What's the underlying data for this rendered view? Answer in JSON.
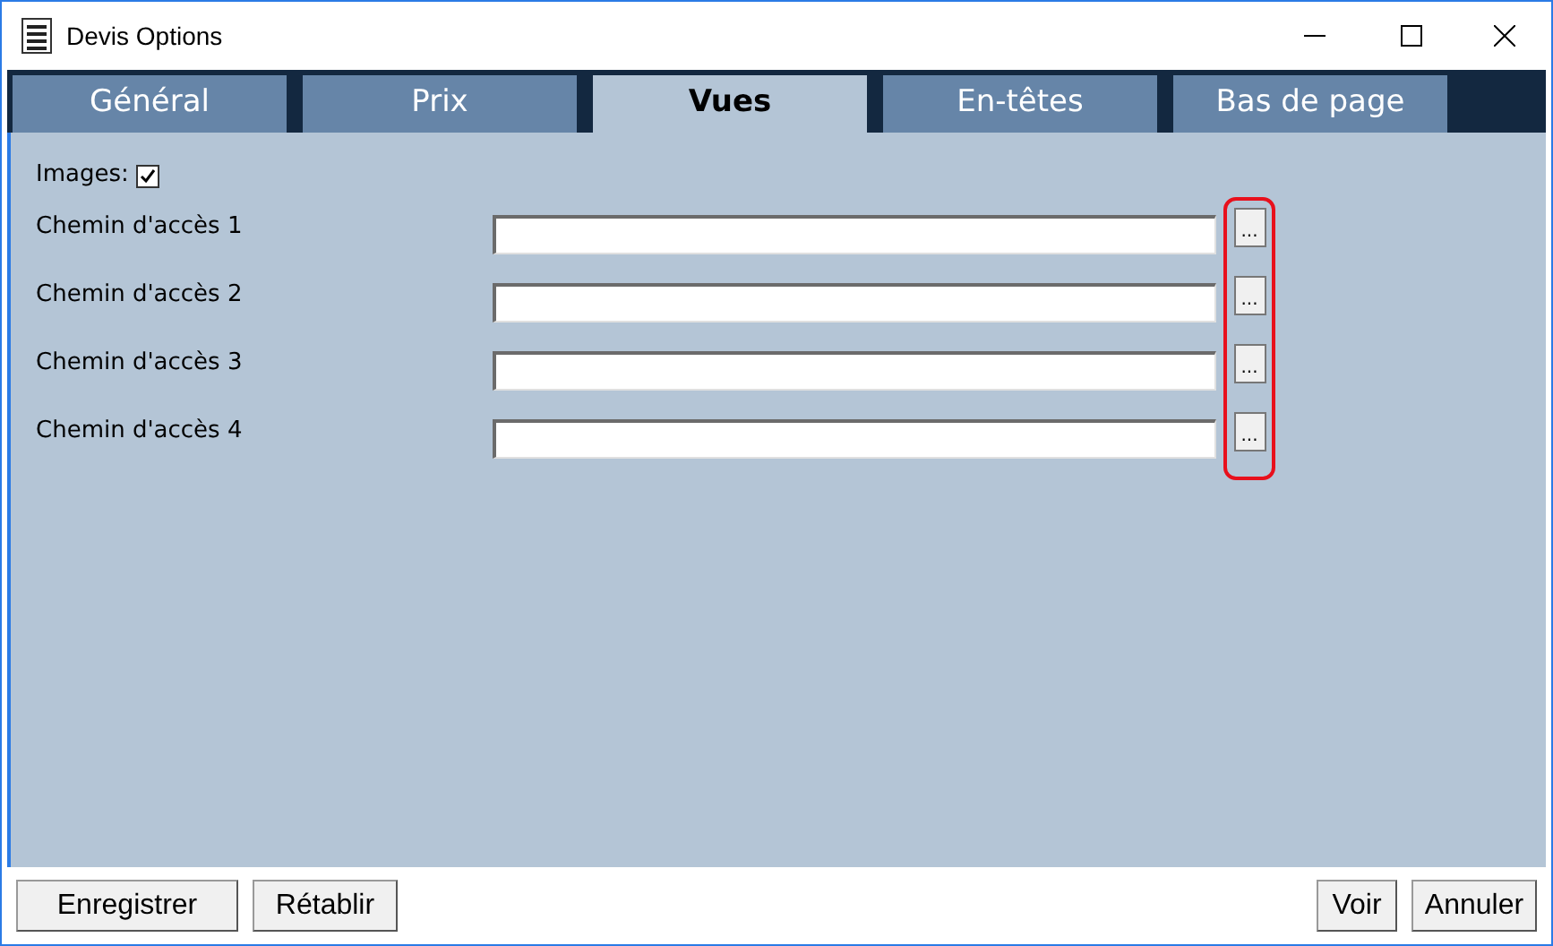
{
  "window": {
    "title": "Devis Options"
  },
  "tabs": [
    {
      "label": "Général",
      "selected": false
    },
    {
      "label": "Prix",
      "selected": false
    },
    {
      "label": "Vues",
      "selected": true
    },
    {
      "label": "En-têtes",
      "selected": false
    },
    {
      "label": "Bas de page",
      "selected": false
    }
  ],
  "images": {
    "label": "Images:",
    "checked": true
  },
  "paths": [
    {
      "label": "Chemin d'accès 1",
      "browse": "..."
    },
    {
      "label": "Chemin d'accès 2",
      "browse": "..."
    },
    {
      "label": "Chemin d'accès 3",
      "browse": "..."
    },
    {
      "label": "Chemin d'accès 4",
      "browse": "..."
    }
  ],
  "buttons_left": [
    "Enregistrer",
    "Rétablir"
  ],
  "buttons_right": [
    "Voir",
    "Annuler"
  ]
}
